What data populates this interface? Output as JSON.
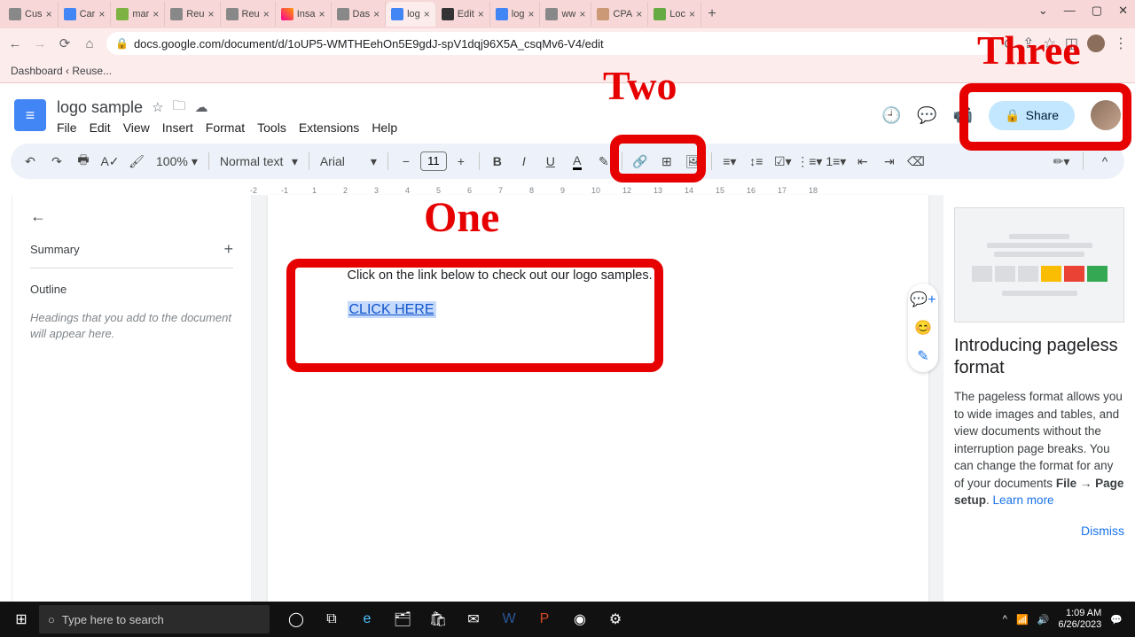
{
  "browser": {
    "tabs": [
      {
        "label": "Cus"
      },
      {
        "label": "Car"
      },
      {
        "label": "mar"
      },
      {
        "label": "Reu"
      },
      {
        "label": "Reu"
      },
      {
        "label": "Insa"
      },
      {
        "label": "Das"
      },
      {
        "label": "log",
        "active": true
      },
      {
        "label": "Edit"
      },
      {
        "label": "log"
      },
      {
        "label": "ww"
      },
      {
        "label": "CPA"
      },
      {
        "label": "Loc"
      }
    ],
    "url": "docs.google.com/document/d/1oUP5-WMTHEehOn5E9gdJ-spV1dqj96X5A_csqMv6-V4/edit",
    "bookmark": "Dashboard ‹ Reuse..."
  },
  "docs": {
    "title": "logo sample",
    "menus": [
      "File",
      "Edit",
      "View",
      "Insert",
      "Format",
      "Tools",
      "Extensions",
      "Help"
    ],
    "share": "Share",
    "zoom": "100%",
    "style": "Normal text",
    "font": "Arial",
    "font_size": "11"
  },
  "left_panel": {
    "summary": "Summary",
    "outline": "Outline",
    "hint": "Headings that you add to the document will appear here."
  },
  "document": {
    "body": "Click on the link below to check out our logo samples.",
    "link_text": "CLICK HERE"
  },
  "right_panel": {
    "title": "Introducing pageless format",
    "body1": "The pageless format allows you to wide images and tables, and view documents without the interruption page breaks. You can change the format for any of your documents",
    "bold": "File → Page setup",
    "learn": "Learn more",
    "dismiss": "Dismiss"
  },
  "annotations": {
    "one": "One",
    "two": "Two",
    "three": "Three"
  },
  "taskbar": {
    "search_placeholder": "Type here to search",
    "time": "1:09 AM",
    "date": "6/26/2023"
  },
  "ruler": [
    "-2",
    "-1",
    "",
    "1",
    "2",
    "3",
    "4",
    "5",
    "6",
    "7",
    "8",
    "9",
    "10",
    "",
    "12",
    "13",
    "14",
    "15",
    "16",
    "17",
    "18"
  ]
}
